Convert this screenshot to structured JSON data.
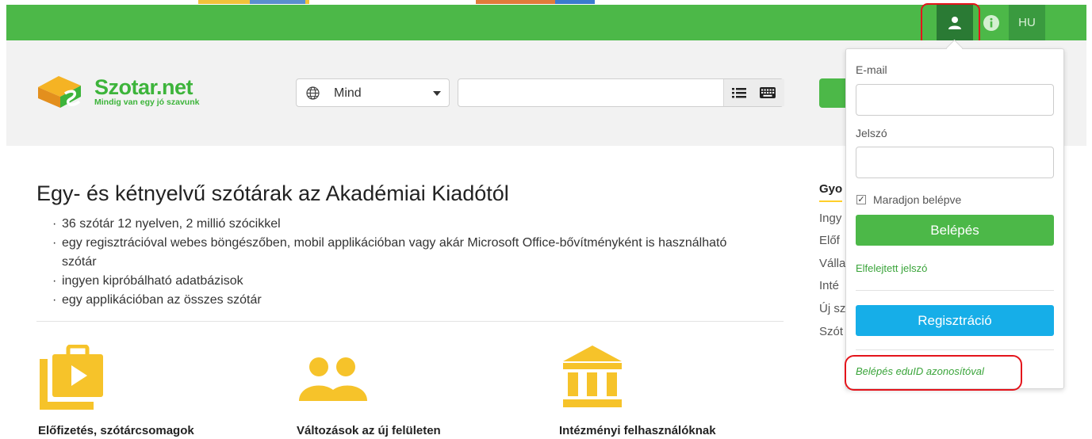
{
  "topbar": {
    "language": "HU",
    "user_icon": "user-icon",
    "info_icon": "info-icon"
  },
  "logo": {
    "name": "Szotar.net",
    "tagline": "Mindig van egy jó szavunk",
    "brand_color": "#3db43b"
  },
  "search": {
    "language_value": "Mind",
    "query_value": "",
    "list_icon": "list-icon",
    "keyboard_icon": "keyboard-icon",
    "globe_icon": "globe-icon"
  },
  "main": {
    "title": "Egy- és kétnyelvű szótárak az Akadémiai Kiadótól",
    "features": [
      "36 szótár 12 nyelven, 2 millió szócikkel",
      "egy regisztrációval webes böngészőben, mobil applikációban vagy akár Microsoft Office-bővítményként is használható szótár",
      "ingyen kipróbálható adatbázisok",
      "egy applikációban az összes szótár"
    ],
    "cards": [
      {
        "label": "Előfizetés, szótárcsomagok",
        "icon": "briefcase-play-icon"
      },
      {
        "label": "Változások az új felületen",
        "icon": "users-icon"
      },
      {
        "label": "Intézményi felhasználóknak",
        "icon": "institution-icon"
      }
    ]
  },
  "sidebar": {
    "heading": "Gyo",
    "links": [
      "Ingy",
      "Előf",
      "Válla",
      "Inté",
      "Új sz",
      "Szót"
    ]
  },
  "login": {
    "email_label": "E-mail",
    "email_value": "",
    "password_label": "Jelszó",
    "password_value": "",
    "remember_label": "Maradjon belépve",
    "remember_checked": true,
    "login_button": "Belépés",
    "forgot_link": "Elfelejtett jelszó",
    "register_button": "Regisztráció",
    "eduid_link": "Belépés eduID azonosítóval"
  },
  "colors": {
    "topbar_green": "#4cb848",
    "accent_yellow": "#ffcf2a",
    "register_blue": "#16aee8",
    "highlight_red": "#e4141b"
  }
}
